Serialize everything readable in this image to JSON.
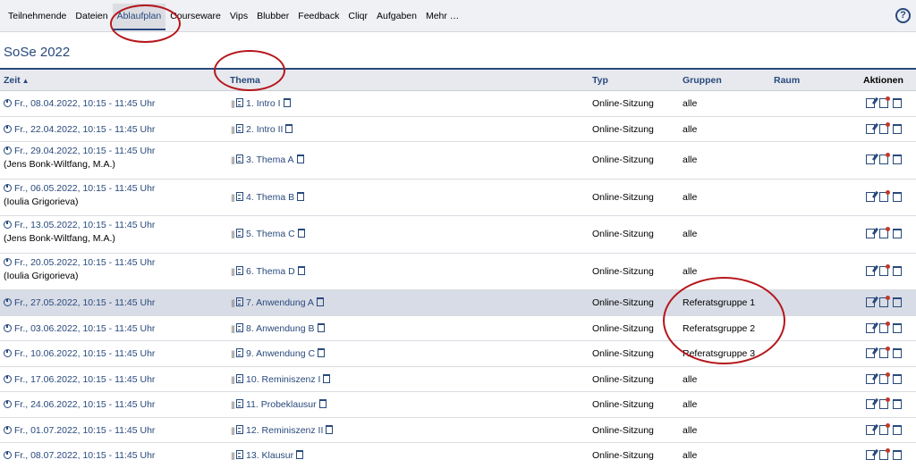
{
  "nav": {
    "tabs": [
      {
        "label": "Teilnehmende"
      },
      {
        "label": "Dateien"
      },
      {
        "label": "Ablaufplan",
        "active": true
      },
      {
        "label": "Courseware"
      },
      {
        "label": "Vips"
      },
      {
        "label": "Blubber"
      },
      {
        "label": "Feedback"
      },
      {
        "label": "Cliqr"
      },
      {
        "label": "Aufgaben"
      },
      {
        "label": "Mehr …"
      }
    ],
    "help": "?"
  },
  "semester": "SoSe 2022",
  "table": {
    "headers": {
      "zeit": "Zeit",
      "thema": "Thema",
      "typ": "Typ",
      "gruppen": "Gruppen",
      "raum": "Raum",
      "aktionen": "Aktionen"
    },
    "rows": [
      {
        "zeit": "Fr., 08.04.2022, 10:15 - 11:45 Uhr",
        "person": "",
        "thema": "1. Intro I",
        "typ": "Online-Sitzung",
        "gruppen": "alle"
      },
      {
        "zeit": "Fr., 22.04.2022, 10:15 - 11:45 Uhr",
        "person": "",
        "thema": "2. Intro II",
        "typ": "Online-Sitzung",
        "gruppen": "alle"
      },
      {
        "zeit": "Fr., 29.04.2022, 10:15 - 11:45 Uhr",
        "person": "(Jens Bonk-Wiltfang, M.A.)",
        "thema": "3. Thema A",
        "typ": "Online-Sitzung",
        "gruppen": "alle"
      },
      {
        "zeit": "Fr., 06.05.2022, 10:15 - 11:45 Uhr",
        "person": "(Ioulia Grigorieva)",
        "thema": "4. Thema B",
        "typ": "Online-Sitzung",
        "gruppen": "alle"
      },
      {
        "zeit": "Fr., 13.05.2022, 10:15 - 11:45 Uhr",
        "person": "(Jens Bonk-Wiltfang, M.A.)",
        "thema": "5. Thema C",
        "typ": "Online-Sitzung",
        "gruppen": "alle"
      },
      {
        "zeit": "Fr., 20.05.2022, 10:15 - 11:45 Uhr",
        "person": "(Ioulia Grigorieva)",
        "thema": "6. Thema D",
        "typ": "Online-Sitzung",
        "gruppen": "alle"
      },
      {
        "zeit": "Fr., 27.05.2022, 10:15 - 11:45 Uhr",
        "person": "",
        "thema": "7. Anwendung A",
        "typ": "Online-Sitzung",
        "gruppen": "Referatsgruppe 1",
        "highlight": true
      },
      {
        "zeit": "Fr., 03.06.2022, 10:15 - 11:45 Uhr",
        "person": "",
        "thema": "8. Anwendung B",
        "typ": "Online-Sitzung",
        "gruppen": "Referatsgruppe 2"
      },
      {
        "zeit": "Fr., 10.06.2022, 10:15 - 11:45 Uhr",
        "person": "",
        "thema": "9. Anwendung C",
        "typ": "Online-Sitzung",
        "gruppen": "Referatsgruppe 3"
      },
      {
        "zeit": "Fr., 17.06.2022, 10:15 - 11:45 Uhr",
        "person": "",
        "thema": "10. Reminiszenz I",
        "typ": "Online-Sitzung",
        "gruppen": "alle"
      },
      {
        "zeit": "Fr., 24.06.2022, 10:15 - 11:45 Uhr",
        "person": "",
        "thema": "11. Probeklausur",
        "typ": "Online-Sitzung",
        "gruppen": "alle"
      },
      {
        "zeit": "Fr., 01.07.2022, 10:15 - 11:45 Uhr",
        "person": "",
        "thema": "12. Reminiszenz II",
        "typ": "Online-Sitzung",
        "gruppen": "alle"
      },
      {
        "zeit": "Fr., 08.07.2022, 10:15 - 11:45 Uhr",
        "person": "",
        "thema": "13. Klausur",
        "typ": "Online-Sitzung",
        "gruppen": "alle"
      }
    ]
  },
  "colors": {
    "accent": "#28497c",
    "annotation": "#b5161b",
    "highlight_row": "#d8dce6"
  }
}
